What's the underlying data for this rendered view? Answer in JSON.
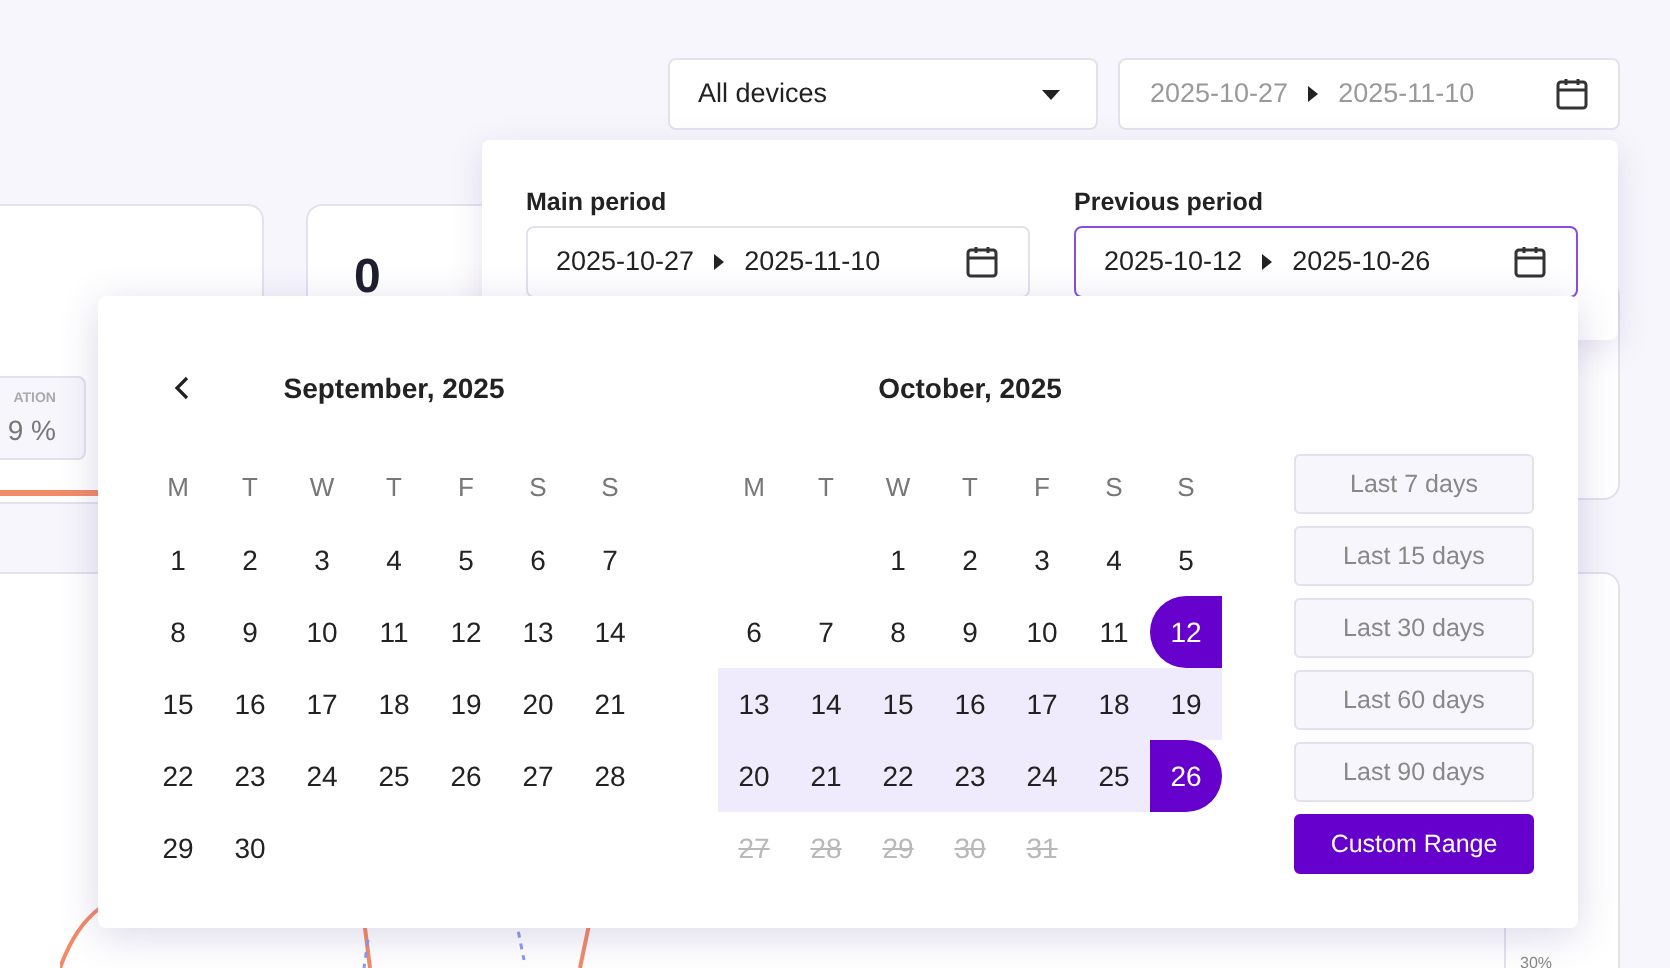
{
  "filters": {
    "device_select": {
      "value": "All devices"
    },
    "date_range": {
      "start": "2025-10-27",
      "end": "2025-11-10"
    }
  },
  "background": {
    "card_value": "0",
    "stat": {
      "label": "ATION",
      "value": "9 %"
    },
    "axis_label": "30%"
  },
  "period_panel": [
    {
      "label": "Main period",
      "start": "2025-10-27",
      "end": "2025-11-10",
      "selected": false
    },
    {
      "label": "Previous period",
      "start": "2025-10-12",
      "end": "2025-10-26",
      "selected": true
    }
  ],
  "calendar": {
    "months": [
      {
        "title": "September, 2025",
        "previous_button": true,
        "weekdays": [
          "M",
          "T",
          "W",
          "T",
          "F",
          "S",
          "S"
        ],
        "days": [
          {
            "label": "1",
            "kind": "normal"
          },
          {
            "label": "2",
            "kind": "normal"
          },
          {
            "label": "3",
            "kind": "normal"
          },
          {
            "label": "4",
            "kind": "normal"
          },
          {
            "label": "5",
            "kind": "normal"
          },
          {
            "label": "6",
            "kind": "normal"
          },
          {
            "label": "7",
            "kind": "normal"
          },
          {
            "label": "8",
            "kind": "normal"
          },
          {
            "label": "9",
            "kind": "normal"
          },
          {
            "label": "10",
            "kind": "normal"
          },
          {
            "label": "11",
            "kind": "normal"
          },
          {
            "label": "12",
            "kind": "normal"
          },
          {
            "label": "13",
            "kind": "normal"
          },
          {
            "label": "14",
            "kind": "normal"
          },
          {
            "label": "15",
            "kind": "normal"
          },
          {
            "label": "16",
            "kind": "normal"
          },
          {
            "label": "17",
            "kind": "normal"
          },
          {
            "label": "18",
            "kind": "normal"
          },
          {
            "label": "19",
            "kind": "normal"
          },
          {
            "label": "20",
            "kind": "normal"
          },
          {
            "label": "21",
            "kind": "normal"
          },
          {
            "label": "22",
            "kind": "normal"
          },
          {
            "label": "23",
            "kind": "normal"
          },
          {
            "label": "24",
            "kind": "normal"
          },
          {
            "label": "25",
            "kind": "normal"
          },
          {
            "label": "26",
            "kind": "normal"
          },
          {
            "label": "27",
            "kind": "normal"
          },
          {
            "label": "28",
            "kind": "normal"
          },
          {
            "label": "29",
            "kind": "normal"
          },
          {
            "label": "30",
            "kind": "normal"
          }
        ]
      },
      {
        "title": "October, 2025",
        "previous_button": false,
        "weekdays": [
          "M",
          "T",
          "W",
          "T",
          "F",
          "S",
          "S"
        ],
        "days": [
          {
            "kind": "blank"
          },
          {
            "kind": "blank"
          },
          {
            "label": "1",
            "kind": "normal"
          },
          {
            "label": "2",
            "kind": "normal"
          },
          {
            "label": "3",
            "kind": "normal"
          },
          {
            "label": "4",
            "kind": "normal"
          },
          {
            "label": "5",
            "kind": "normal"
          },
          {
            "label": "6",
            "kind": "normal"
          },
          {
            "label": "7",
            "kind": "normal"
          },
          {
            "label": "8",
            "kind": "normal"
          },
          {
            "label": "9",
            "kind": "normal"
          },
          {
            "label": "10",
            "kind": "normal"
          },
          {
            "label": "11",
            "kind": "normal"
          },
          {
            "label": "12",
            "kind": "range_start"
          },
          {
            "label": "13",
            "kind": "in_range"
          },
          {
            "label": "14",
            "kind": "in_range"
          },
          {
            "label": "15",
            "kind": "in_range"
          },
          {
            "label": "16",
            "kind": "in_range"
          },
          {
            "label": "17",
            "kind": "in_range"
          },
          {
            "label": "18",
            "kind": "in_range"
          },
          {
            "label": "19",
            "kind": "in_range"
          },
          {
            "label": "20",
            "kind": "in_range"
          },
          {
            "label": "21",
            "kind": "in_range"
          },
          {
            "label": "22",
            "kind": "in_range"
          },
          {
            "label": "23",
            "kind": "in_range"
          },
          {
            "label": "24",
            "kind": "in_range"
          },
          {
            "label": "25",
            "kind": "in_range"
          },
          {
            "label": "26",
            "kind": "range_end"
          },
          {
            "label": "27",
            "kind": "disabled"
          },
          {
            "label": "28",
            "kind": "disabled"
          },
          {
            "label": "29",
            "kind": "disabled"
          },
          {
            "label": "30",
            "kind": "disabled"
          },
          {
            "label": "31",
            "kind": "disabled"
          }
        ]
      }
    ],
    "presets": [
      {
        "label": "Last 7 days",
        "selected": false
      },
      {
        "label": "Last 15 days",
        "selected": false
      },
      {
        "label": "Last 30 days",
        "selected": false
      },
      {
        "label": "Last 60 days",
        "selected": false
      },
      {
        "label": "Last 90 days",
        "selected": false
      },
      {
        "label": "Custom Range",
        "selected": true
      }
    ]
  }
}
